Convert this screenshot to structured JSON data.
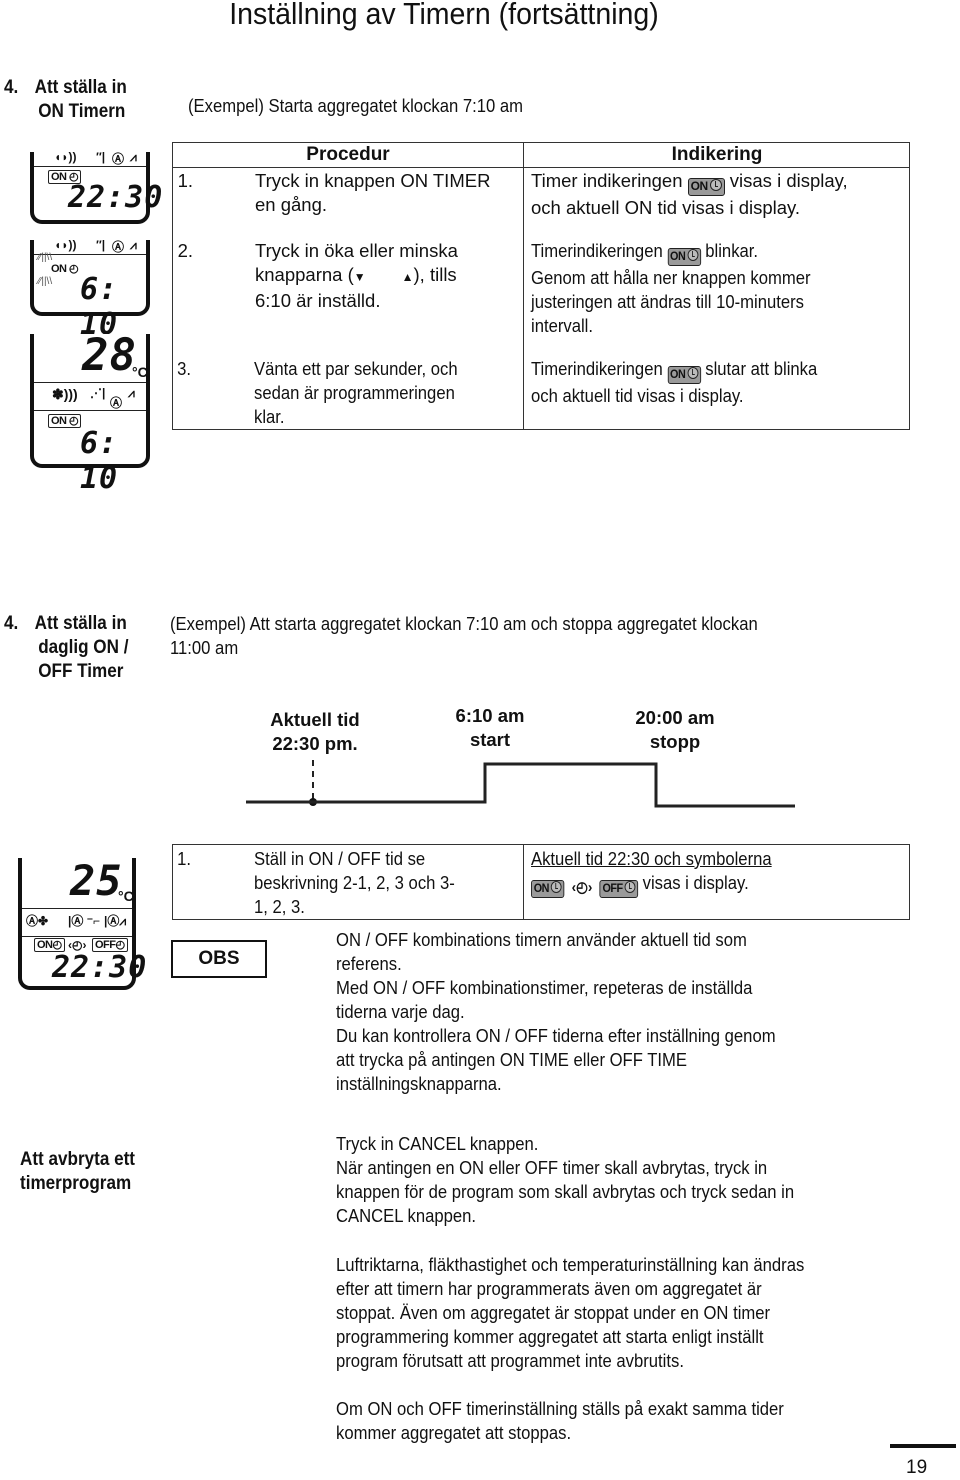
{
  "page_title": "Inställning av Timern (fortsättning)",
  "section_on_timer": {
    "number": "4.",
    "label_lines": [
      "Att ställa in",
      "ON Timern"
    ],
    "example": "(Exempel) Starta aggregatet klockan 7:10 am",
    "table": {
      "headers": [
        "Procedur",
        "Indikering"
      ],
      "rows": [
        {
          "num": "1.",
          "procedure_lines": [
            "Tryck in knappen ON TIMER",
            "en gång."
          ],
          "indication_lines": [
            "Timer indikeringen",
            "visas i display,",
            "och aktuell ON tid visas i display."
          ]
        },
        {
          "num": "2.",
          "procedure_lines": [
            "Tryck in öka eller minska",
            "knapparna (",
            "), tills",
            "6:10 är inställd."
          ],
          "indication_lines": [
            "Timerindikeringen",
            "blinkar.",
            "Genom att hålla ner knappen kommer",
            "justeringen att ändras till 10-minuters",
            "intervall."
          ]
        },
        {
          "num": "3.",
          "procedure_lines": [
            "Vänta ett par sekunder, och",
            "sedan är programmeringen",
            "klar."
          ],
          "indication_lines": [
            "Timerindikeringen",
            "slutar att blinka",
            "och aktuell tid visas i display."
          ]
        }
      ]
    },
    "displays": [
      {
        "time": "22:30",
        "timer_badge": "ON",
        "icons": [
          "fan-speed-icon",
          "swing-icon",
          "auto-icon",
          "louver-icon"
        ]
      },
      {
        "time": "6: 10",
        "timer_badge": "ON",
        "blinking": true,
        "icons": [
          "fan-speed-icon",
          "swing-icon",
          "auto-icon",
          "louver-icon"
        ]
      },
      {
        "temperature": "28",
        "unit": "°C",
        "time": "6: 10",
        "timer_badge": "ON",
        "icons": [
          "fan-speed-icon",
          "swing-icon",
          "auto-icon",
          "louver-icon"
        ]
      }
    ],
    "badge_text": "ON"
  },
  "section_on_off_timer": {
    "number": "4.",
    "label_lines": [
      "Att ställa in",
      "daglig ON /",
      "OFF Timer"
    ],
    "example_lines": [
      "(Exempel) Att starta aggregatet klockan 7:10 am och stoppa aggregatet klockan",
      "11:00 am"
    ],
    "timeline": {
      "current": [
        "Aktuell tid",
        "22:30 pm."
      ],
      "start": [
        "6:10 am",
        "start"
      ],
      "stop": [
        "20:00 am",
        "stopp"
      ]
    },
    "display": {
      "temperature": "25",
      "unit": "°C",
      "time": "22:30",
      "badges": [
        "ON",
        "OFF"
      ]
    },
    "table": {
      "num": "1.",
      "procedure_lines": [
        "Ställ in ON / OFF tid se",
        "beskrivning 2-1, 2, 3 och 3-",
        "1, 2, 3."
      ],
      "indication_lines": [
        "Aktuell tid 22:30 och symbolerna",
        "visas i display."
      ]
    },
    "obs_label": "OBS",
    "obs_lines": [
      "ON / OFF kombinations timern använder aktuell tid som",
      "referens.",
      "Med ON / OFF kombinationstimer, repeteras de inställda",
      "tiderna varje dag.",
      "Du kan kontrollera ON / OFF tiderna efter inställning genom",
      "att trycka på antingen ON TIME eller OFF TIME",
      "inställningsknapparna."
    ]
  },
  "section_cancel": {
    "label_lines": [
      "Att avbryta ett",
      "timerprogram"
    ],
    "para1_lines": [
      "Tryck in CANCEL knappen.",
      "När antingen en ON eller OFF timer skall avbrytas, tryck in",
      "knappen för de program som skall avbrytas och tryck sedan in",
      "CANCEL knappen."
    ],
    "para2_lines": [
      "Luftriktarna, fläkthastighet och temperaturinställning kan ändras",
      "efter att timern har programmerats även om aggregatet är",
      "stoppat. Även om aggregatet är stoppat under en ON timer",
      "programmering kommer aggregatet att starta enligt inställt",
      "program förutsatt att programmet inte avbrutits."
    ],
    "para3_lines": [
      "Om ON och OFF timerinställning ställs på exakt samma tider",
      "kommer aggregatet att stoppas."
    ]
  },
  "page_number": "19"
}
